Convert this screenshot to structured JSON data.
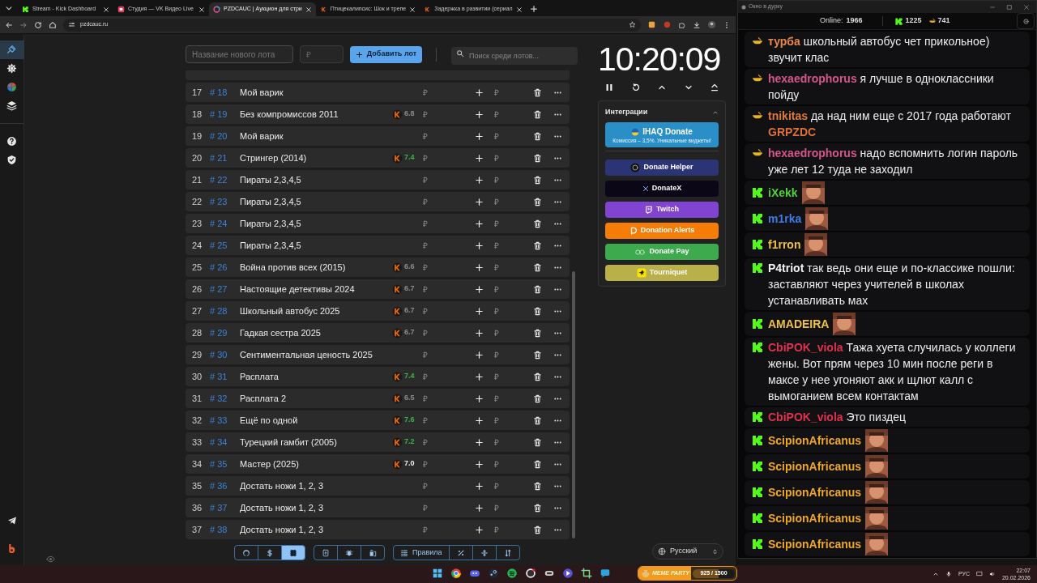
{
  "browser": {
    "tabs": [
      {
        "title": "Stream - Kick Dashboard",
        "selected": false
      },
      {
        "title": "Студия — VK Видео Live",
        "selected": false
      },
      {
        "title": "PZDCAUC | Аукцион для стри",
        "selected": true
      },
      {
        "title": "Птицекалипсис: Шок и трепе",
        "selected": false
      },
      {
        "title": "Задержка в развитии (сериал",
        "selected": false
      }
    ],
    "address": "pzdcauc.ru"
  },
  "sidebar": {
    "items": [
      {
        "selected": true
      },
      {
        "selected": false
      },
      {
        "selected": false
      },
      {
        "selected": false
      },
      {
        "selected": false
      },
      {
        "selected": false
      }
    ]
  },
  "toolbar": {
    "name_placeholder": "Название нового лота",
    "price_placeholder": "₽",
    "add_button": "Добавить лот",
    "search_placeholder": "Поиск среди лотов..."
  },
  "lots": [
    {
      "number": "17",
      "id": "# 18",
      "title": "Мой варик",
      "amount_placeholder": "₽",
      "add_placeholder": "₽"
    },
    {
      "number": "18",
      "id": "# 19",
      "title": "Без компромиссов 2011",
      "rating": "6.8",
      "color": "#8c8c8c",
      "amount_placeholder": "₽",
      "add_placeholder": "₽"
    },
    {
      "number": "19",
      "id": "# 20",
      "title": "Мой варик",
      "amount_placeholder": "₽",
      "add_placeholder": "₽"
    },
    {
      "number": "20",
      "id": "# 21",
      "title": "Стрингер (2014)",
      "rating": "7.4",
      "color": "#3bb54a",
      "amount_placeholder": "₽",
      "add_placeholder": "₽"
    },
    {
      "number": "21",
      "id": "# 22",
      "title": "Пираты 2,3,4,5",
      "amount_placeholder": "₽",
      "add_placeholder": "₽"
    },
    {
      "number": "22",
      "id": "# 23",
      "title": "Пираты 2,3,4,5",
      "amount_placeholder": "₽",
      "add_placeholder": "₽"
    },
    {
      "number": "23",
      "id": "# 24",
      "title": "Пираты 2,3,4,5",
      "amount_placeholder": "₽",
      "add_placeholder": "₽"
    },
    {
      "number": "24",
      "id": "# 25",
      "title": "Пираты 2,3,4,5",
      "amount_placeholder": "₽",
      "add_placeholder": "₽"
    },
    {
      "number": "25",
      "id": "# 26",
      "title": "Война против всех (2015)",
      "rating": "6.6",
      "color": "#8c8c8c",
      "amount_placeholder": "₽",
      "add_placeholder": "₽"
    },
    {
      "number": "26",
      "id": "# 27",
      "title": "Настоящие детективы 2024",
      "rating": "6.7",
      "color": "#8c8c8c",
      "amount_placeholder": "₽",
      "add_placeholder": "₽"
    },
    {
      "number": "27",
      "id": "# 28",
      "title": "Школьный автобус 2025",
      "rating": "6.7",
      "color": "#8c8c8c",
      "amount_placeholder": "₽",
      "add_placeholder": "₽"
    },
    {
      "number": "28",
      "id": "# 29",
      "title": "Гадкая сестра 2025",
      "rating": "6.7",
      "color": "#8c8c8c",
      "amount_placeholder": "₽",
      "add_placeholder": "₽"
    },
    {
      "number": "29",
      "id": "# 30",
      "title": "Сентиментальная ценость 2025",
      "amount_placeholder": "₽",
      "add_placeholder": "₽"
    },
    {
      "number": "30",
      "id": "# 31",
      "title": "Расплата",
      "rating": "7.4",
      "color": "#3bb54a",
      "amount_placeholder": "₽",
      "add_placeholder": "₽"
    },
    {
      "number": "31",
      "id": "# 32",
      "title": "Расплата 2",
      "rating": "6.5",
      "color": "#8c8c8c",
      "amount_placeholder": "₽",
      "add_placeholder": "₽"
    },
    {
      "number": "32",
      "id": "# 33",
      "title": "Ещё по одной",
      "rating": "7.6",
      "color": "#3bb54a",
      "amount_placeholder": "₽",
      "add_placeholder": "₽"
    },
    {
      "number": "33",
      "id": "# 34",
      "title": "Турецкий гамбит (2005)",
      "rating": "7.2",
      "color": "#3bb54a",
      "amount_placeholder": "₽",
      "add_placeholder": "₽"
    },
    {
      "number": "34",
      "id": "# 35",
      "title": "Мастер (2025)",
      "rating": "7.0",
      "color": "#f0f0f0",
      "amount_placeholder": "₽",
      "add_placeholder": "₽"
    },
    {
      "number": "35",
      "id": "# 36",
      "title": "Достать ножи 1, 2, 3",
      "amount_placeholder": "₽",
      "add_placeholder": "₽"
    },
    {
      "number": "36",
      "id": "# 37",
      "title": "Достать ножи 1, 2, 3",
      "amount_placeholder": "₽",
      "add_placeholder": "₽"
    },
    {
      "number": "37",
      "id": "# 38",
      "title": "Достать ножи 1, 2, 3",
      "amount_placeholder": "₽",
      "add_placeholder": "₽"
    }
  ],
  "timer": "10:20:09",
  "integrations": {
    "title": "Интеграции",
    "expanded": true,
    "items": [
      {
        "label": "IHAQ Donate",
        "subtitle": "Комиссия – 3,5%. Уникальные виджеты!",
        "color": "#2a8fc7"
      },
      {
        "label": "Donate Helper",
        "color": "#2b3576"
      },
      {
        "label": "DonateX",
        "color": "#0c0716"
      },
      {
        "label": "Twitch",
        "color": "#8144d0"
      },
      {
        "label": "Donation Alerts",
        "color": "#f57d07"
      },
      {
        "label": "Donate Pay",
        "color": "#3dab4d"
      },
      {
        "label": "Tourniquet",
        "color": "#b9b04a"
      }
    ]
  },
  "bottom_toolbar": {
    "groups": [
      [
        {
          "selected": false
        },
        {
          "selected": false
        },
        {
          "selected": true
        }
      ],
      [
        {
          "selected": false
        },
        {
          "selected": false
        },
        {
          "selected": false
        }
      ],
      [
        {
          "label": "Правила",
          "selected": false
        },
        {
          "selected": false
        },
        {
          "selected": false
        },
        {
          "selected": false
        }
      ]
    ]
  },
  "language": "Русский",
  "chat": {
    "window_title": "Окно в дурку",
    "online_label": "Online:",
    "online": "1966",
    "kick_count": "1225",
    "vk_count": "741",
    "messages": [
      {
        "kind": "vk",
        "user": "турба",
        "color": "#e8884a",
        "text": "школьный автобус чет прикольное) звучит клас"
      },
      {
        "kind": "vk",
        "user": "hexaedrophorus",
        "color": "#d6568c",
        "text": "я лучше в одноклассники пойду"
      },
      {
        "kind": "vk",
        "user": "tnikitas",
        "color": "#e07a3c",
        "text": "да над ним еще с 2017 года работают",
        "mention": "GRPZDC"
      },
      {
        "kind": "vk",
        "user": "hexaedrophorus",
        "color": "#d6568c",
        "text": "надо вспомнить логин пароль уже лет 12 туда не заходил"
      },
      {
        "kind": "kick",
        "user": "iXekk",
        "color": "#4ed23a",
        "has_emote": true
      },
      {
        "kind": "kick",
        "user": "m1rka",
        "color": "#3b7bea",
        "has_emote": true
      },
      {
        "kind": "kick",
        "user": "f1rron",
        "color": "#f0c040",
        "has_emote": true
      },
      {
        "kind": "kick",
        "user": "P4triot",
        "color": "#f2f2f2",
        "text": "так ведь они еще и по-классике пошли: заставляют через учителей в школах устанавливать мах"
      },
      {
        "kind": "kick",
        "user": "AMADEIRA",
        "color": "#f0c040",
        "has_emote": true
      },
      {
        "kind": "kick",
        "user": "CbiPOK_viola",
        "color": "#e0314f",
        "text": "Тажа хуета случилась у коллеги жены. Вот прям через 10 мин после реги в максе у нее угоняют акк и щлют калл с вымоганием всем контактам"
      },
      {
        "kind": "kick",
        "user": "CbiPOK_viola",
        "color": "#e0314f",
        "text": "Это пиздец"
      },
      {
        "kind": "kick",
        "user": "ScipionAfricanus",
        "color": "#f2a81e",
        "has_emote": true
      },
      {
        "kind": "kick",
        "user": "ScipionAfricanus",
        "color": "#f2a81e",
        "has_emote": true
      },
      {
        "kind": "kick",
        "user": "ScipionAfricanus",
        "color": "#f2a81e",
        "has_emote": true
      },
      {
        "kind": "kick",
        "user": "ScipionAfricanus",
        "color": "#f2a81e",
        "has_emote": true
      },
      {
        "kind": "kick",
        "user": "ScipionAfricanus",
        "color": "#f2a81e",
        "has_emote": true
      }
    ]
  },
  "taskbar": {
    "widget_title": "MEME PARTY",
    "widget_progress": "925 / 1500",
    "level": 0.617,
    "language": "РУС",
    "time": "22:07",
    "date": "20.02.2026"
  }
}
